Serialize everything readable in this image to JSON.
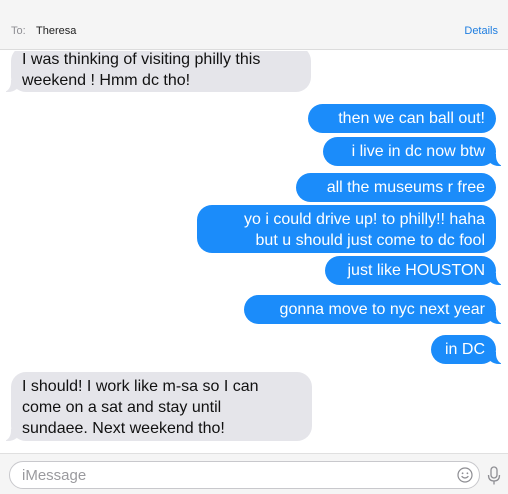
{
  "header": {
    "to_label": "To:",
    "contact_name": "Theresa",
    "details_label": "Details"
  },
  "messages": [
    {
      "direction": "incoming",
      "lines": [
        "I was thinking of visiting philly this",
        "weekend ! Hmm dc tho!"
      ]
    },
    {
      "direction": "outgoing",
      "lines": [
        "then we can ball out!"
      ]
    },
    {
      "direction": "outgoing",
      "lines": [
        "i live in dc now btw"
      ]
    },
    {
      "direction": "outgoing",
      "lines": [
        "all the museums r free"
      ]
    },
    {
      "direction": "outgoing",
      "lines": [
        "yo i could drive up! to philly!! haha",
        "but u should just come to dc fool"
      ]
    },
    {
      "direction": "outgoing",
      "lines": [
        "just like HOUSTON"
      ]
    },
    {
      "direction": "outgoing",
      "lines": [
        "gonna move to nyc next year"
      ]
    },
    {
      "direction": "outgoing",
      "lines": [
        "in DC"
      ]
    },
    {
      "direction": "incoming",
      "lines": [
        "I should! I work like m-sa so I can",
        "come on a sat and stay until",
        "sundaee. Next weekend tho!"
      ]
    }
  ],
  "composer": {
    "placeholder": "iMessage",
    "value": "",
    "emoji_icon": "emoji-icon",
    "mic_icon": "microphone-icon"
  },
  "colors": {
    "outgoing_bubble": "#1b8cfa",
    "incoming_bubble": "#e5e5ea",
    "accent": "#1f7ee0"
  }
}
